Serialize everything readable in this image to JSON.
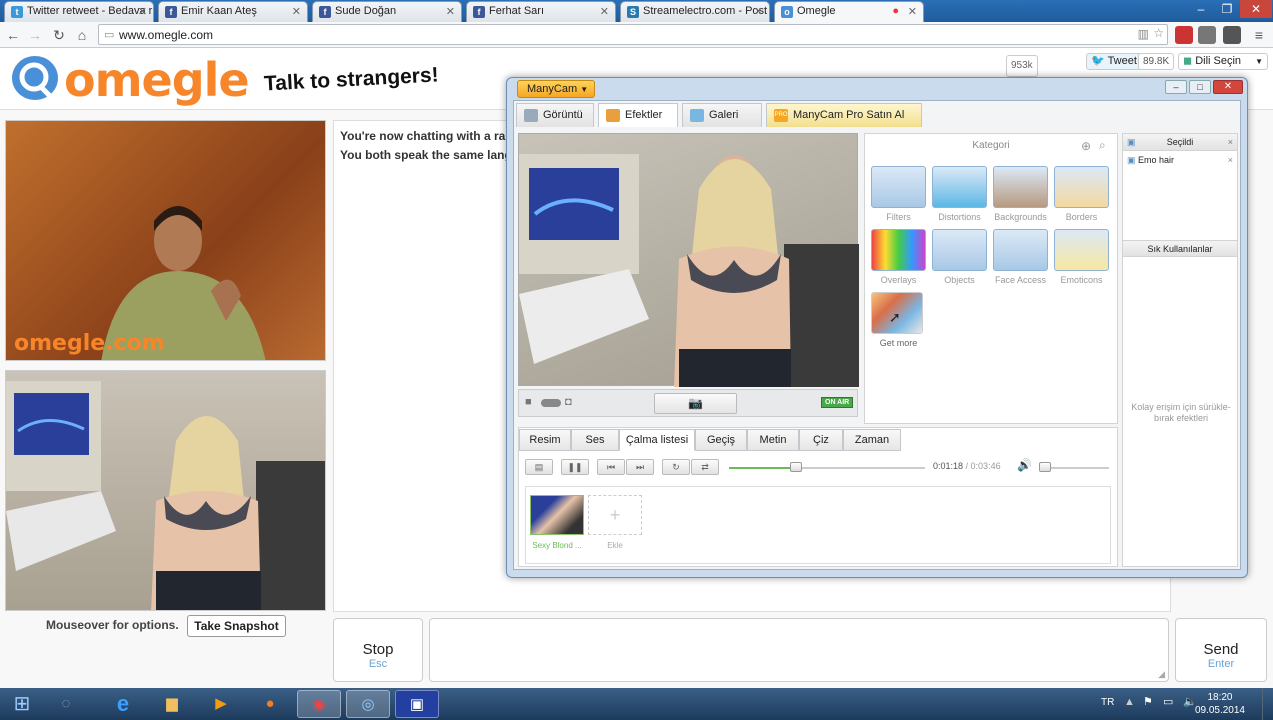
{
  "browser": {
    "tabs": [
      {
        "title": "Twitter retweet - Bedava r",
        "icon": "twitter-icon",
        "color": "#3a9ad9"
      },
      {
        "title": "Emir Kaan Ateş",
        "icon": "facebook-icon",
        "color": "#3b5998"
      },
      {
        "title": "Sude Doğan",
        "icon": "facebook-icon",
        "color": "#3b5998"
      },
      {
        "title": "Ferhat Sarı",
        "icon": "facebook-icon",
        "color": "#3b5998"
      },
      {
        "title": "Streamelectro.com - Post",
        "icon": "blog-icon",
        "color": "#2a7ab0"
      },
      {
        "title": "Omegle",
        "icon": "omegle-icon",
        "color": "#4a90d9"
      }
    ],
    "url": "www.omegle.com"
  },
  "omegle": {
    "logo": "omegle",
    "tagline": "Talk to strangers!",
    "chat_messages": [
      "You're now chatting with a ran",
      "You both speak the same lang"
    ],
    "watermark": "omegle.com",
    "mouseover_text": "Mouseover for options.",
    "snapshot_button": "Take Snapshot",
    "stop": {
      "label": "Stop",
      "key": "Esc"
    },
    "send": {
      "label": "Send",
      "key": "Enter"
    },
    "share": {
      "count_top": "953k",
      "tweet": "Tweet",
      "tweet_count": "89.8K",
      "language": "Dili Seçin"
    }
  },
  "manycam": {
    "menu": "ManyCam",
    "tabs": [
      "Görüntü",
      "Efektler",
      "Galeri",
      "ManyCam Pro Satın Al"
    ],
    "active_tab": "Efektler",
    "pro_badge": "PRO",
    "on_air": "ON AIR",
    "category_title": "Kategori",
    "categories": [
      "Filters",
      "Distortions",
      "Backgrounds",
      "Borders",
      "Overlays",
      "Objects",
      "Face Access",
      "Emoticons",
      "Get more"
    ],
    "selected_title": "Seçildi",
    "selected_items": [
      "Emo hair"
    ],
    "favorites_title": "Sık Kullanılanlar",
    "favorites_hint": "Kolay erişim için sürükle-bırak efektleri",
    "subtabs": [
      "Resim",
      "Ses",
      "Çalma listesi",
      "Geçiş",
      "Metin",
      "Çiz",
      "Zaman"
    ],
    "active_subtab": "Çalma listesi",
    "time_current": "0:01:18",
    "time_total": "/ 0:03:46",
    "progress": 0.34,
    "playlist": [
      {
        "label": "Sexy Blond ..."
      },
      {
        "label": "Ekle"
      }
    ]
  },
  "taskbar": {
    "lang": "TR",
    "time": "18:20",
    "date": "09.05.2014"
  }
}
